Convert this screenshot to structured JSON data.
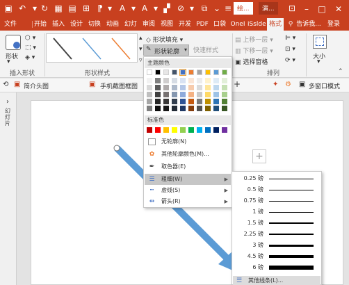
{
  "titlebar": {
    "tab_drawing": "绘...",
    "tab_show": "演...",
    "win_restore": "□",
    "win_close": "✕"
  },
  "ribbon_tabs": [
    "文件",
    "开始",
    "插入",
    "设计",
    "切换",
    "动画",
    "幻灯片",
    "审阅",
    "视图",
    "开发",
    "PDF",
    "口袋",
    "OneI",
    "iSlide",
    "格式"
  ],
  "ribbon_tabs_display": [
    "文件",
    "开始",
    "插入",
    "设计",
    "切换",
    "动画",
    "幻灯",
    "审阅",
    "视图",
    "开发",
    "PDF",
    "口袋",
    "OneI",
    "iSslde",
    "格式"
  ],
  "tell_me": "告诉我...",
  "login": "登录",
  "ribbon": {
    "shape_label": "形状",
    "insert_shapes_group": "插入形状",
    "shape_styles_group": "形状样式",
    "shape_fill": "形状填充",
    "shape_outline": "形状轮廓",
    "wordart_quick": "快速样式",
    "bring_forward": "上移一层",
    "send_backward": "下移一层",
    "selection_pane": "选择窗格",
    "arrange_group": "排列",
    "size_label": "大小"
  },
  "cmdbar": {
    "item1": "简介头图",
    "item2": "手机截图框图",
    "item3": "多窗口模式"
  },
  "leftpane": {
    "expand": "›",
    "label": "幻灯片"
  },
  "outline_menu": {
    "theme_colors": "主题颜色",
    "standard_colors": "标准色",
    "no_outline": "无轮廓(N)",
    "more_colors": "其他轮廓颜色(M)...",
    "eyedropper": "取色器(E)",
    "weight": "粗细(W)",
    "dashes": "虚线(S)",
    "arrows": "箭头(R)"
  },
  "theme_top_row": [
    "#ffffff",
    "#000000",
    "#e7e6e6",
    "#44546a",
    "#4472c4",
    "#ed7d31",
    "#a5a5a5",
    "#ffc000",
    "#5b9bd5",
    "#70ad47"
  ],
  "theme_columns": [
    [
      "#f2f2f2",
      "#d9d9d9",
      "#bfbfbf",
      "#a6a6a6",
      "#808080"
    ],
    [
      "#808080",
      "#595959",
      "#404040",
      "#262626",
      "#0d0d0d"
    ],
    [
      "#d0cece",
      "#aeaaaa",
      "#767171",
      "#3a3838",
      "#171616"
    ],
    [
      "#d6dce4",
      "#adb9ca",
      "#8497b0",
      "#333f4f",
      "#222a35"
    ],
    [
      "#d9e2f3",
      "#b4c6e7",
      "#8eaadb",
      "#2f5496",
      "#1f3864"
    ],
    [
      "#fbe5d5",
      "#f7cbac",
      "#f4b183",
      "#c55a11",
      "#843c0c"
    ],
    [
      "#ededed",
      "#dbdbdb",
      "#c9c9c9",
      "#7b7b7b",
      "#525252"
    ],
    [
      "#fff2cc",
      "#ffe699",
      "#ffd966",
      "#bf9000",
      "#7f6000"
    ],
    [
      "#deebf6",
      "#bdd7ee",
      "#9dc3e6",
      "#2e75b5",
      "#1f4e79"
    ],
    [
      "#e2efd9",
      "#c5e0b3",
      "#a8d08d",
      "#538135",
      "#375623"
    ]
  ],
  "standard_colors": [
    "#c00000",
    "#ff0000",
    "#ffc000",
    "#ffff00",
    "#92d050",
    "#00b050",
    "#00b0f0",
    "#0070c0",
    "#002060",
    "#7030a0"
  ],
  "weight_menu": {
    "items": [
      "0.25 磅",
      "0.5 磅",
      "0.75 磅",
      "1 磅",
      "1.5 磅",
      "2.25 磅",
      "3 磅",
      "4.5 磅",
      "6 磅"
    ],
    "more": "其他线条(L)..."
  },
  "accent": "#c8401f",
  "arrow_color": "#5b9bd5"
}
